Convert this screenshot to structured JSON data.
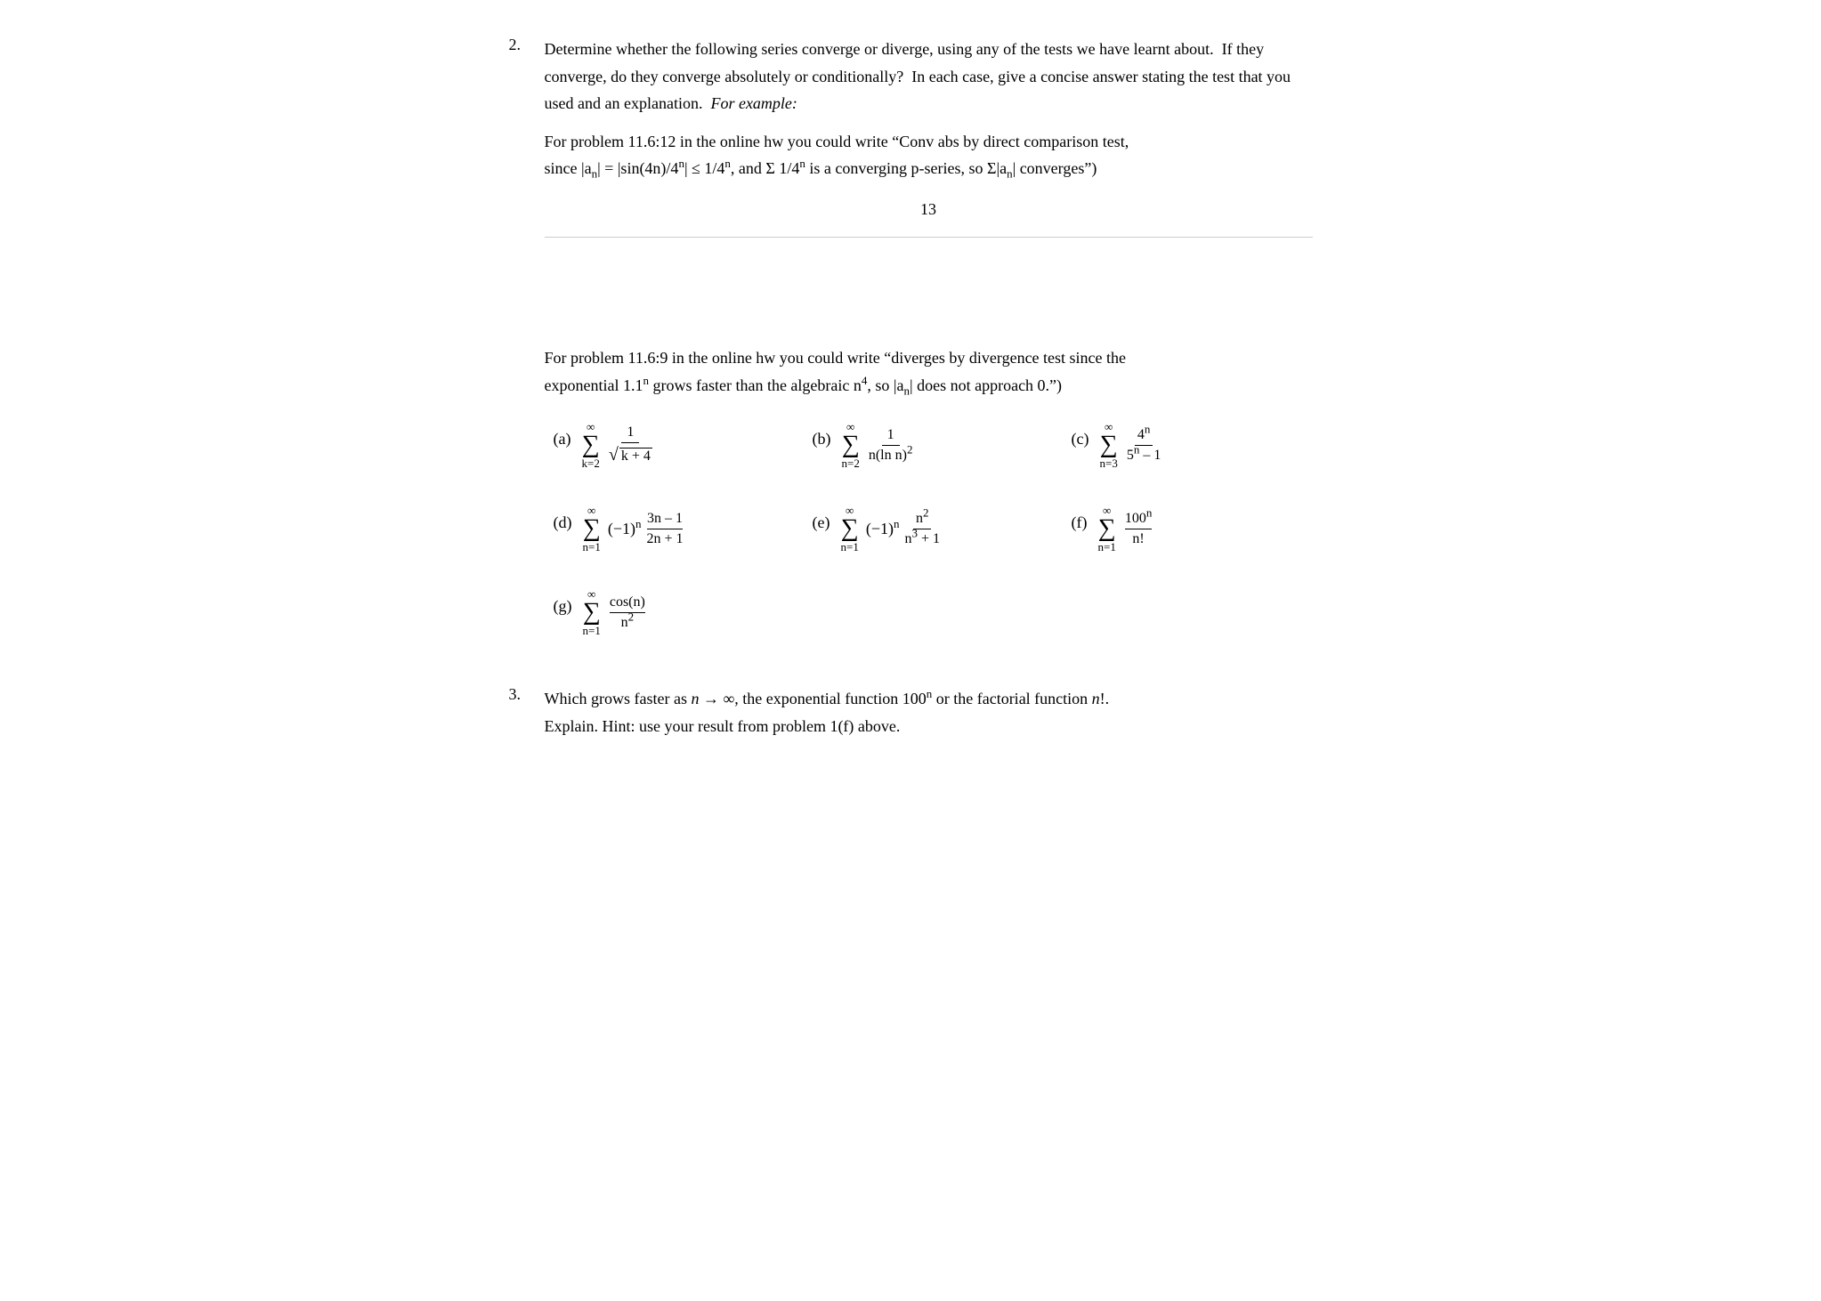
{
  "problem2": {
    "number": "2.",
    "text1": "Determine whether the following series converge or diverge, using any of the tests we have learnt about.  If they converge, do they converge absolutely or conditionally?  In each case, give a concise answer stating the test that you used and an explanation.",
    "italic_example": "For example:",
    "example_line1": "For problem 11.6:12 in the online hw you could write “Conv abs by direct comparison test,",
    "example_line2_pre": "since |a",
    "example_line2_n1": "n",
    "example_line2_mid": "| = |sin(4n)/4",
    "example_line2_n2": "n",
    "example_line2_mid2": "| ≤ 1/4",
    "example_line2_n3": "n",
    "example_line2_mid3": ", and Σ 1/4",
    "example_line2_n4": "n",
    "example_line2_end": " is a converging p-series, so Σ|a",
    "example_line2_n5": "n",
    "example_line2_close": "| converges”)",
    "page_number": "13",
    "for_problem_text1": "For problem 11.6:9 in the online hw you could write “diverges by divergence test since the",
    "for_problem_text2": "exponential 1.1",
    "for_problem_text2_n": "n",
    "for_problem_text2_rest": " grows faster than the algebraic n",
    "for_problem_text2_4": "4",
    "for_problem_text2_end": ", so |a",
    "for_problem_text2_n2": "n",
    "for_problem_text2_close": "| does not approach 0.”)",
    "series": {
      "a_label": "(a)",
      "a_sum_from": "k=2",
      "a_sum_to": "∞",
      "a_numerator": "1",
      "a_denominator_sqrt": "k + 4",
      "b_label": "(b)",
      "b_sum_from": "n=2",
      "b_sum_to": "∞",
      "b_numerator": "1",
      "b_denominator": "n(ln n)",
      "b_denom_sup": "2",
      "c_label": "(c)",
      "c_sum_from": "n=3",
      "c_sum_to": "∞",
      "c_numerator": "4",
      "c_num_sup": "n",
      "c_denominator": "5",
      "c_denom_sup": "n",
      "c_denom_rest": "– 1",
      "d_label": "(d)",
      "d_sum_from": "n=1",
      "d_sum_to": "∞",
      "d_sign": "(−1)",
      "d_sign_sup": "n",
      "d_numerator": "3n – 1",
      "d_denominator": "2n + 1",
      "e_label": "(e)",
      "e_sum_from": "n=1",
      "e_sum_to": "∞",
      "e_sign": "(−1)",
      "e_sign_sup": "n",
      "e_numerator": "n",
      "e_num_sup": "2",
      "e_denominator": "n",
      "e_denom_sup": "3",
      "e_denom_rest": "+ 1",
      "f_label": "(f)",
      "f_sum_from": "n=1",
      "f_sum_to": "∞",
      "f_numerator": "100",
      "f_num_sup": "n",
      "f_denominator": "n!",
      "g_label": "(g)",
      "g_sum_from": "n=1",
      "g_sum_to": "∞",
      "g_numerator": "cos(n)",
      "g_denominator": "n",
      "g_denom_sup": "2"
    }
  },
  "problem3": {
    "number": "3.",
    "text": "Which grows faster as n → ∞, the exponential function 100",
    "text_sup": "n",
    "text_end": " or the factorial function n!.",
    "text2": "Explain. Hint: use your result from problem 1(f) above."
  }
}
